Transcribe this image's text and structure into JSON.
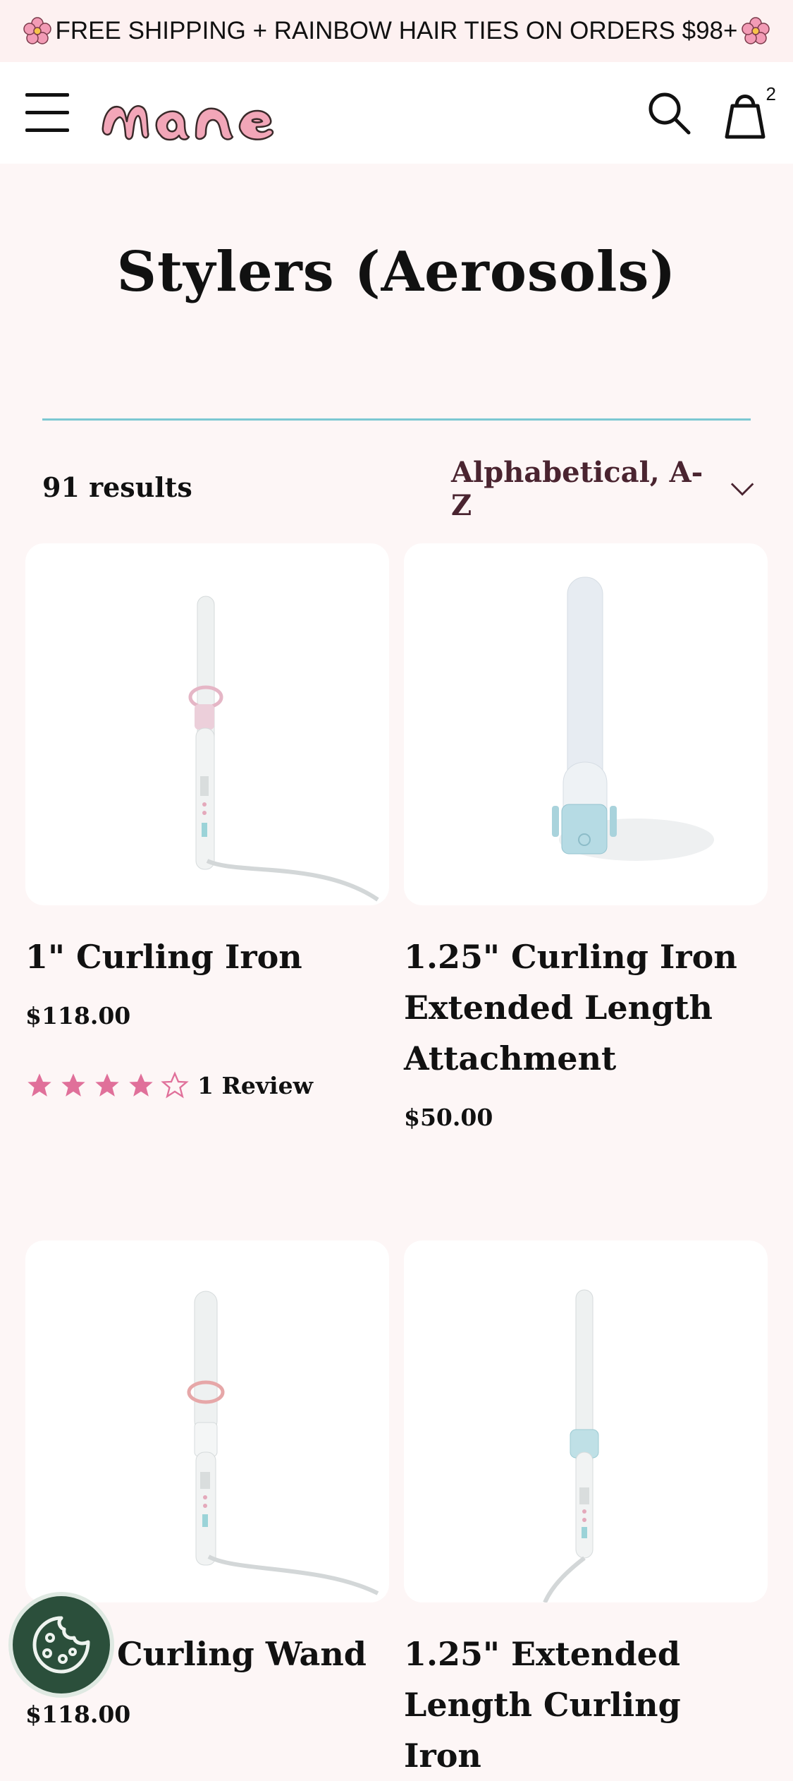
{
  "announcement": {
    "text": "FREE SHIPPING + RAINBOW HAIR TIES ON ORDERS $98+"
  },
  "header": {
    "logo_text": "mane",
    "cart_count": "2",
    "icons": [
      "hamburger-icon",
      "search-icon",
      "bag-icon"
    ]
  },
  "collection": {
    "title": "Stylers (Aerosols)",
    "results_count": "91 results",
    "sort_label": "Alphabetical, A-Z"
  },
  "products": [
    {
      "title": "1\" Curling Iron",
      "price": "$118.00",
      "rating": 4,
      "rating_max": 5,
      "reviews": "1 Review"
    },
    {
      "title": "1.25\" Curling Iron Extended Length Attachment",
      "price": "$50.00"
    },
    {
      "title": "Curling Wand",
      "price": "$118.00"
    },
    {
      "title": "1.25\" Extended Length Curling Iron"
    }
  ],
  "colors": {
    "accent_teal": "#7cc8d2",
    "star_pink": "#e0709a",
    "logo_pink": "#f2a6b8",
    "sort_text": "#4a2430",
    "cookie_green": "#2b4f3b"
  }
}
